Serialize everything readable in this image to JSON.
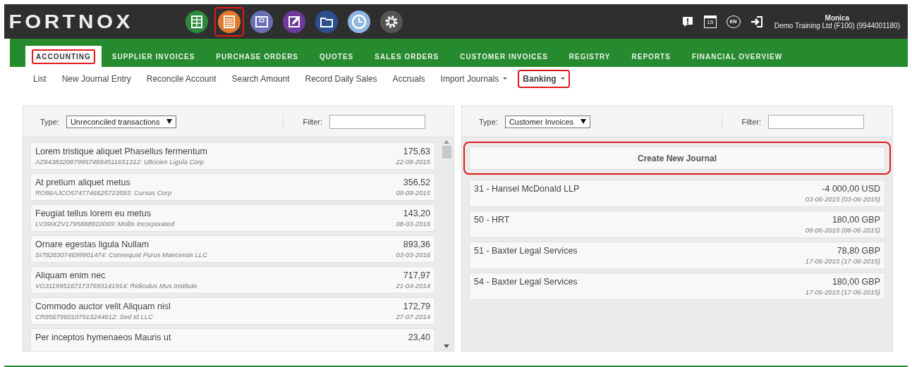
{
  "header": {
    "logo": "FORTNOX",
    "apps": [
      {
        "kind": "table",
        "color": "#2a8a3c",
        "highlighted": false
      },
      {
        "kind": "list",
        "color": "#e07a2e",
        "highlighted": true
      },
      {
        "kind": "window",
        "color": "#6a6fb5",
        "highlighted": false
      },
      {
        "kind": "edit",
        "color": "#6d3a9c",
        "highlighted": false
      },
      {
        "kind": "folder",
        "color": "#2d4f8e",
        "highlighted": false
      },
      {
        "kind": "clock",
        "color": "#8fb5e3",
        "highlighted": false
      },
      {
        "kind": "gear",
        "color": "#555555",
        "highlighted": false
      }
    ],
    "tools": [
      {
        "kind": "alert"
      },
      {
        "kind": "calendar",
        "label": "15"
      },
      {
        "kind": "chat",
        "label": "EN"
      },
      {
        "kind": "logout"
      }
    ],
    "user": {
      "name": "Monica",
      "company": "Demo Training Ltd (F100) (9944001180)"
    }
  },
  "nav": [
    {
      "label": "ACCOUNTING",
      "selected": true,
      "highlighted": true
    },
    {
      "label": "SUPPLIER INVOICES",
      "selected": false,
      "highlighted": false
    },
    {
      "label": "PURCHASE ORDERS",
      "selected": false,
      "highlighted": false
    },
    {
      "label": "QUOTES",
      "selected": false,
      "highlighted": false
    },
    {
      "label": "SALES ORDERS",
      "selected": false,
      "highlighted": false
    },
    {
      "label": "CUSTOMER INVOICES",
      "selected": false,
      "highlighted": false
    },
    {
      "label": "REGISTRY",
      "selected": false,
      "highlighted": false
    },
    {
      "label": "REPORTS",
      "selected": false,
      "highlighted": false
    },
    {
      "label": "FINANCIAL OVERVIEW",
      "selected": false,
      "highlighted": false
    }
  ],
  "subnav": [
    {
      "label": "List",
      "dropdown": false,
      "selected": false
    },
    {
      "label": "New Journal Entry",
      "dropdown": false,
      "selected": false
    },
    {
      "label": "Reconcile Account",
      "dropdown": false,
      "selected": false
    },
    {
      "label": "Search Amount",
      "dropdown": false,
      "selected": false
    },
    {
      "label": "Record Daily Sales",
      "dropdown": false,
      "selected": false
    },
    {
      "label": "Accruals",
      "dropdown": false,
      "selected": false
    },
    {
      "label": "Import Journals",
      "dropdown": true,
      "selected": false
    },
    {
      "label": "Banking",
      "dropdown": true,
      "selected": true
    }
  ],
  "left_panel": {
    "type_label": "Type:",
    "type_value": "Unreconciled transactions",
    "filter_label": "Filter:",
    "rows": [
      {
        "title": "Lorem tristique aliquet Phasellus fermentum",
        "detail": "AZ84383208799574884511651312: Ultricies Ligula Corp",
        "amount": "175,63",
        "date": "22-08-2015"
      },
      {
        "title": "At pretium aliquet metus",
        "detail": "RO86AJCO5747746625723593: Cursus Corp",
        "amount": "356,52",
        "date": "09-09-2015"
      },
      {
        "title": "Feugiat tellus lorem eu metus",
        "detail": "LV39IXZV1795888910069: Mollis Incorporated",
        "amount": "143,20",
        "date": "08-03-2016"
      },
      {
        "title": "Ornare egestas ligula Nullam",
        "detail": "SI78283074699901474: Consequat Purus Maecenas LLC",
        "amount": "893,36",
        "date": "03-03-2016"
      },
      {
        "title": "Aliquam enim nec",
        "detail": "VG3119951671737693141914: Ridiculus Mus Institute",
        "amount": "717,97",
        "date": "21-04-2014"
      },
      {
        "title": "Commodo auctor velit Aliquam nisl",
        "detail": "CR8567960107913244612: Sed Id LLC",
        "amount": "172,79",
        "date": "27-07-2014"
      },
      {
        "title": "Per inceptos hymenaeos Mauris ut",
        "amount": "23,40"
      }
    ]
  },
  "right_panel": {
    "type_label": "Type:",
    "type_value": "Customer Invoices",
    "filter_label": "Filter:",
    "button": {
      "label": "Create New Journal",
      "highlighted": true
    },
    "rows": [
      {
        "title": "31 - Hansel McDonald LLP",
        "amount": "-4 000,00 USD",
        "date": "03-06-2015 (03-06-2015)"
      },
      {
        "title": "50 - HRT",
        "amount": "180,00 GBP",
        "date": "08-06-2015 (08-06-2015)"
      },
      {
        "title": "51 - Baxter Legal Services",
        "amount": "78,80 GBP",
        "date": "17-06-2015 (17-06-2015)"
      },
      {
        "title": "54 - Baxter Legal Services",
        "amount": "180,00 GBP",
        "date": "17-06-2015 (17-06-2015)"
      }
    ]
  }
}
